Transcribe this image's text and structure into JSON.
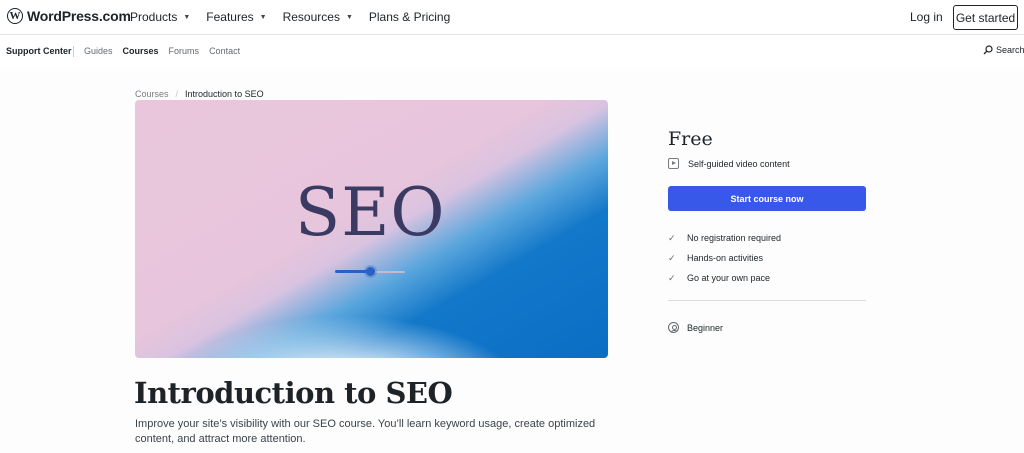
{
  "header": {
    "logo_mark": "W",
    "logo_text": "WordPress.com",
    "nav": [
      {
        "label": "Products",
        "caret": "▼"
      },
      {
        "label": "Features",
        "caret": "▼"
      },
      {
        "label": "Resources",
        "caret": "▼"
      },
      {
        "label": "Plans & Pricing",
        "caret": ""
      }
    ],
    "login_label": "Log in",
    "get_started_label": "Get started"
  },
  "subnav": {
    "title": "Support Center",
    "links": [
      "Guides",
      "Courses",
      "Forums",
      "Contact"
    ],
    "active_link": "Courses",
    "search_label": "Search"
  },
  "breadcrumb": {
    "parent": "Courses",
    "separator": "/",
    "current": "Introduction to SEO"
  },
  "hero": {
    "text": "SEO",
    "slider_level_percent": 51
  },
  "course": {
    "title": "Introduction to SEO",
    "description": "Improve your site’s visibility with our SEO course. You’ll learn keyword usage, create optimized content, and attract more attention."
  },
  "sidebar": {
    "price": "Free",
    "content_type": "Self-guided video content",
    "cta_label": "Start course now",
    "features": [
      "No registration required",
      "Hands-on activities",
      "Go at your own pace"
    ],
    "level": "Beginner"
  },
  "colors": {
    "accent": "#3858e9",
    "text": "#1d2327"
  },
  "icons": {
    "check": "✓"
  }
}
